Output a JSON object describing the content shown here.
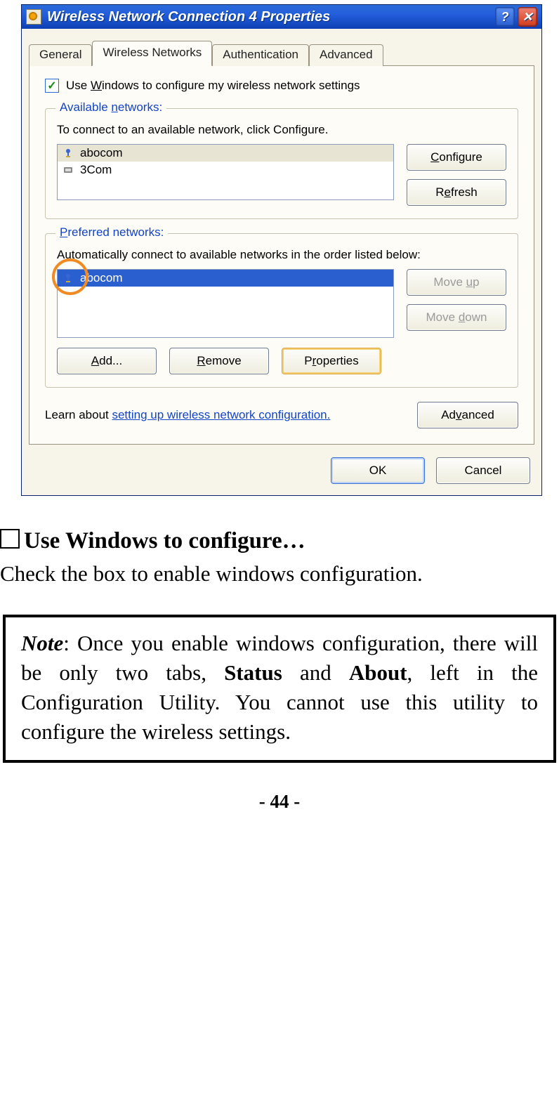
{
  "window": {
    "title": "Wireless Network Connection 4 Properties",
    "help_glyph": "?",
    "close_glyph": "✕"
  },
  "tabs": [
    "General",
    "Wireless Networks",
    "Authentication",
    "Advanced"
  ],
  "checkbox_label_pre": "Use ",
  "checkbox_label_u": "W",
  "checkbox_label_post": "indows to configure my wireless network settings",
  "available": {
    "legend_pre": "Available ",
    "legend_u": "n",
    "legend_post": "etworks:",
    "desc": "To connect to an available network, click Configure.",
    "items": [
      {
        "name": "abocom",
        "icon": "wifi-key"
      },
      {
        "name": "3Com",
        "icon": "adapter"
      }
    ],
    "configure_u": "C",
    "configure_post": "onfigure",
    "refresh_pre": "R",
    "refresh_u": "e",
    "refresh_post": "fresh"
  },
  "preferred": {
    "legend_pre": "",
    "legend_u": "P",
    "legend_post": "referred networks:",
    "desc": "Automatically connect to available networks in the order listed below:",
    "items": [
      {
        "name": "abocom",
        "icon": "wifi-key"
      }
    ],
    "moveup_pre": "Move ",
    "moveup_u": "u",
    "moveup_post": "p",
    "movedown_pre": "Move ",
    "movedown_u": "d",
    "movedown_post": "own",
    "add_u": "A",
    "add_post": "dd...",
    "remove_u": "R",
    "remove_post": "emove",
    "props_pre": "P",
    "props_u": "r",
    "props_post": "operties"
  },
  "learn_pre": "Learn about ",
  "learn_link": "setting up wireless network configuration.",
  "advanced_pre": "Ad",
  "advanced_u": "v",
  "advanced_post": "anced",
  "ok": "OK",
  "cancel": "Cancel",
  "doc": {
    "heading": "Use Windows to configure…",
    "lead": "Check the box to enable windows configuration.",
    "note_label": "Note",
    "note_t1": ": Once you enable windows configuration, there will be only two tabs, ",
    "note_b1": "Status",
    "note_t2": " and ",
    "note_b2": "About",
    "note_t3": ", left in the Configuration Utility.  You cannot use this utility to configure the wireless settings.",
    "pagenum": "- 44 -"
  }
}
